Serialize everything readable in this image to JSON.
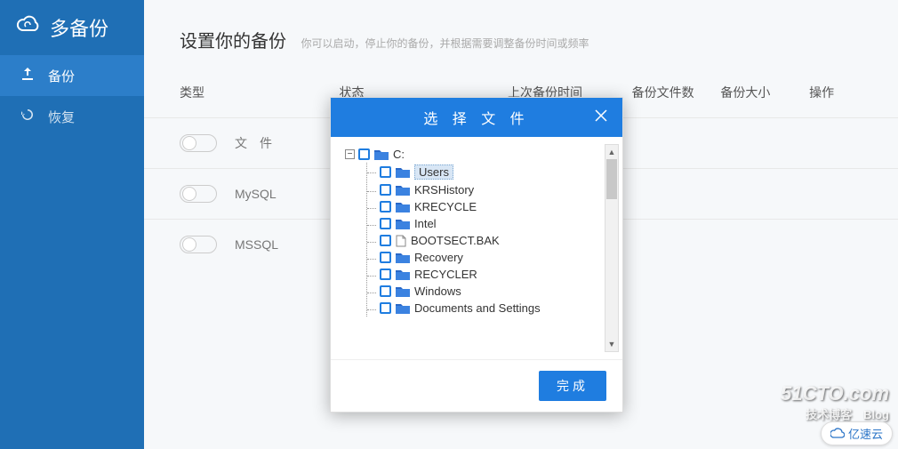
{
  "brand": "多备份",
  "nav": {
    "backup": "备份",
    "restore": "恢复"
  },
  "header": {
    "title": "设置你的备份",
    "subtitle": "你可以启动，停止你的备份，并根据需要调整备份时间或频率"
  },
  "columns": {
    "type": "类型",
    "status": "状态",
    "last": "上次备份时间",
    "files": "备份文件数",
    "size": "备份大小",
    "op": "操作"
  },
  "rows": [
    {
      "label": "文　件"
    },
    {
      "label": "MySQL"
    },
    {
      "label": "MSSQL"
    }
  ],
  "modal": {
    "title": "选 择 文 件",
    "done": "完成",
    "tree": {
      "root_label": "C:",
      "children": [
        {
          "label": "Users",
          "icon": "folder",
          "selected": true
        },
        {
          "label": "KRSHistory",
          "icon": "folder"
        },
        {
          "label": "KRECYCLE",
          "icon": "folder"
        },
        {
          "label": "Intel",
          "icon": "folder"
        },
        {
          "label": "BOOTSECT.BAK",
          "icon": "file"
        },
        {
          "label": "Recovery",
          "icon": "folder"
        },
        {
          "label": "RECYCLER",
          "icon": "folder"
        },
        {
          "label": "Windows",
          "icon": "folder"
        },
        {
          "label": "Documents and Settings",
          "icon": "folder"
        }
      ]
    }
  },
  "watermark": {
    "line1": "51CTO.com",
    "line2": "技术博客　Blog"
  },
  "badge": "亿速云"
}
